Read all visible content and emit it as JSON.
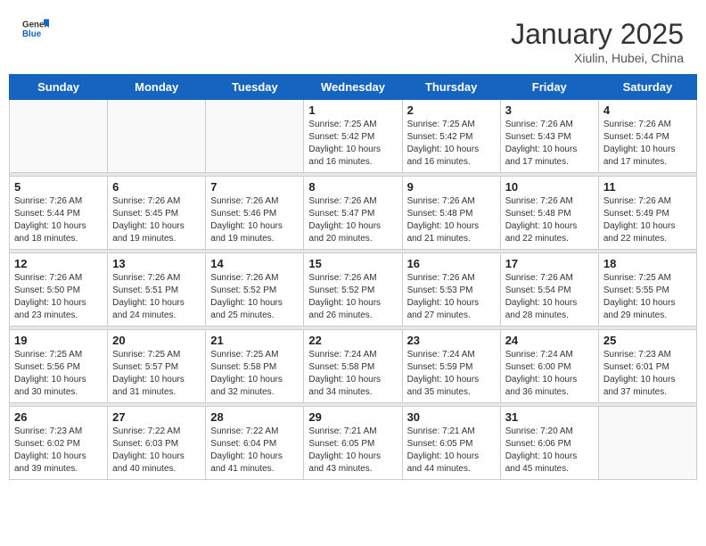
{
  "header": {
    "logo_general": "General",
    "logo_blue": "Blue",
    "title": "January 2025",
    "subtitle": "Xiulin, Hubei, China"
  },
  "days_of_week": [
    "Sunday",
    "Monday",
    "Tuesday",
    "Wednesday",
    "Thursday",
    "Friday",
    "Saturday"
  ],
  "weeks": [
    [
      {
        "day": "",
        "sunrise": "",
        "sunset": "",
        "daylight": ""
      },
      {
        "day": "",
        "sunrise": "",
        "sunset": "",
        "daylight": ""
      },
      {
        "day": "",
        "sunrise": "",
        "sunset": "",
        "daylight": ""
      },
      {
        "day": "1",
        "sunrise": "Sunrise: 7:25 AM",
        "sunset": "Sunset: 5:42 PM",
        "daylight": "Daylight: 10 hours and 16 minutes."
      },
      {
        "day": "2",
        "sunrise": "Sunrise: 7:25 AM",
        "sunset": "Sunset: 5:42 PM",
        "daylight": "Daylight: 10 hours and 16 minutes."
      },
      {
        "day": "3",
        "sunrise": "Sunrise: 7:26 AM",
        "sunset": "Sunset: 5:43 PM",
        "daylight": "Daylight: 10 hours and 17 minutes."
      },
      {
        "day": "4",
        "sunrise": "Sunrise: 7:26 AM",
        "sunset": "Sunset: 5:44 PM",
        "daylight": "Daylight: 10 hours and 17 minutes."
      }
    ],
    [
      {
        "day": "5",
        "sunrise": "Sunrise: 7:26 AM",
        "sunset": "Sunset: 5:44 PM",
        "daylight": "Daylight: 10 hours and 18 minutes."
      },
      {
        "day": "6",
        "sunrise": "Sunrise: 7:26 AM",
        "sunset": "Sunset: 5:45 PM",
        "daylight": "Daylight: 10 hours and 19 minutes."
      },
      {
        "day": "7",
        "sunrise": "Sunrise: 7:26 AM",
        "sunset": "Sunset: 5:46 PM",
        "daylight": "Daylight: 10 hours and 19 minutes."
      },
      {
        "day": "8",
        "sunrise": "Sunrise: 7:26 AM",
        "sunset": "Sunset: 5:47 PM",
        "daylight": "Daylight: 10 hours and 20 minutes."
      },
      {
        "day": "9",
        "sunrise": "Sunrise: 7:26 AM",
        "sunset": "Sunset: 5:48 PM",
        "daylight": "Daylight: 10 hours and 21 minutes."
      },
      {
        "day": "10",
        "sunrise": "Sunrise: 7:26 AM",
        "sunset": "Sunset: 5:48 PM",
        "daylight": "Daylight: 10 hours and 22 minutes."
      },
      {
        "day": "11",
        "sunrise": "Sunrise: 7:26 AM",
        "sunset": "Sunset: 5:49 PM",
        "daylight": "Daylight: 10 hours and 22 minutes."
      }
    ],
    [
      {
        "day": "12",
        "sunrise": "Sunrise: 7:26 AM",
        "sunset": "Sunset: 5:50 PM",
        "daylight": "Daylight: 10 hours and 23 minutes."
      },
      {
        "day": "13",
        "sunrise": "Sunrise: 7:26 AM",
        "sunset": "Sunset: 5:51 PM",
        "daylight": "Daylight: 10 hours and 24 minutes."
      },
      {
        "day": "14",
        "sunrise": "Sunrise: 7:26 AM",
        "sunset": "Sunset: 5:52 PM",
        "daylight": "Daylight: 10 hours and 25 minutes."
      },
      {
        "day": "15",
        "sunrise": "Sunrise: 7:26 AM",
        "sunset": "Sunset: 5:52 PM",
        "daylight": "Daylight: 10 hours and 26 minutes."
      },
      {
        "day": "16",
        "sunrise": "Sunrise: 7:26 AM",
        "sunset": "Sunset: 5:53 PM",
        "daylight": "Daylight: 10 hours and 27 minutes."
      },
      {
        "day": "17",
        "sunrise": "Sunrise: 7:26 AM",
        "sunset": "Sunset: 5:54 PM",
        "daylight": "Daylight: 10 hours and 28 minutes."
      },
      {
        "day": "18",
        "sunrise": "Sunrise: 7:25 AM",
        "sunset": "Sunset: 5:55 PM",
        "daylight": "Daylight: 10 hours and 29 minutes."
      }
    ],
    [
      {
        "day": "19",
        "sunrise": "Sunrise: 7:25 AM",
        "sunset": "Sunset: 5:56 PM",
        "daylight": "Daylight: 10 hours and 30 minutes."
      },
      {
        "day": "20",
        "sunrise": "Sunrise: 7:25 AM",
        "sunset": "Sunset: 5:57 PM",
        "daylight": "Daylight: 10 hours and 31 minutes."
      },
      {
        "day": "21",
        "sunrise": "Sunrise: 7:25 AM",
        "sunset": "Sunset: 5:58 PM",
        "daylight": "Daylight: 10 hours and 32 minutes."
      },
      {
        "day": "22",
        "sunrise": "Sunrise: 7:24 AM",
        "sunset": "Sunset: 5:58 PM",
        "daylight": "Daylight: 10 hours and 34 minutes."
      },
      {
        "day": "23",
        "sunrise": "Sunrise: 7:24 AM",
        "sunset": "Sunset: 5:59 PM",
        "daylight": "Daylight: 10 hours and 35 minutes."
      },
      {
        "day": "24",
        "sunrise": "Sunrise: 7:24 AM",
        "sunset": "Sunset: 6:00 PM",
        "daylight": "Daylight: 10 hours and 36 minutes."
      },
      {
        "day": "25",
        "sunrise": "Sunrise: 7:23 AM",
        "sunset": "Sunset: 6:01 PM",
        "daylight": "Daylight: 10 hours and 37 minutes."
      }
    ],
    [
      {
        "day": "26",
        "sunrise": "Sunrise: 7:23 AM",
        "sunset": "Sunset: 6:02 PM",
        "daylight": "Daylight: 10 hours and 39 minutes."
      },
      {
        "day": "27",
        "sunrise": "Sunrise: 7:22 AM",
        "sunset": "Sunset: 6:03 PM",
        "daylight": "Daylight: 10 hours and 40 minutes."
      },
      {
        "day": "28",
        "sunrise": "Sunrise: 7:22 AM",
        "sunset": "Sunset: 6:04 PM",
        "daylight": "Daylight: 10 hours and 41 minutes."
      },
      {
        "day": "29",
        "sunrise": "Sunrise: 7:21 AM",
        "sunset": "Sunset: 6:05 PM",
        "daylight": "Daylight: 10 hours and 43 minutes."
      },
      {
        "day": "30",
        "sunrise": "Sunrise: 7:21 AM",
        "sunset": "Sunset: 6:05 PM",
        "daylight": "Daylight: 10 hours and 44 minutes."
      },
      {
        "day": "31",
        "sunrise": "Sunrise: 7:20 AM",
        "sunset": "Sunset: 6:06 PM",
        "daylight": "Daylight: 10 hours and 45 minutes."
      },
      {
        "day": "",
        "sunrise": "",
        "sunset": "",
        "daylight": ""
      }
    ]
  ]
}
